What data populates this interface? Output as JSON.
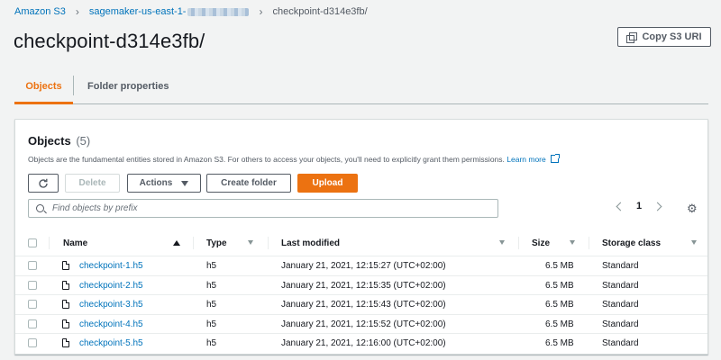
{
  "breadcrumb": {
    "root": "Amazon S3",
    "bucket": "sagemaker-us-east-1-",
    "current": "checkpoint-d314e3fb/"
  },
  "page_title": "checkpoint-d314e3fb/",
  "copy_button": "Copy S3 URI",
  "tabs": [
    {
      "label": "Objects",
      "active": true
    },
    {
      "label": "Folder properties",
      "active": false
    }
  ],
  "panel": {
    "title": "Objects",
    "count": "(5)",
    "description": "Objects are the fundamental entities stored in Amazon S3. For others to access your objects, you'll need to explicitly grant them permissions.",
    "learn_more": "Learn more"
  },
  "toolbar": {
    "delete": "Delete",
    "actions": "Actions",
    "create_folder": "Create folder",
    "upload": "Upload"
  },
  "search": {
    "placeholder": "Find objects by prefix"
  },
  "pagination": {
    "page": "1"
  },
  "columns": [
    "Name",
    "Type",
    "Last modified",
    "Size",
    "Storage class"
  ],
  "rows": [
    {
      "name": "checkpoint-1.h5",
      "type": "h5",
      "modified": "January 21, 2021, 12:15:27 (UTC+02:00)",
      "size": "6.5 MB",
      "storage": "Standard"
    },
    {
      "name": "checkpoint-2.h5",
      "type": "h5",
      "modified": "January 21, 2021, 12:15:35 (UTC+02:00)",
      "size": "6.5 MB",
      "storage": "Standard"
    },
    {
      "name": "checkpoint-3.h5",
      "type": "h5",
      "modified": "January 21, 2021, 12:15:43 (UTC+02:00)",
      "size": "6.5 MB",
      "storage": "Standard"
    },
    {
      "name": "checkpoint-4.h5",
      "type": "h5",
      "modified": "January 21, 2021, 12:15:52 (UTC+02:00)",
      "size": "6.5 MB",
      "storage": "Standard"
    },
    {
      "name": "checkpoint-5.h5",
      "type": "h5",
      "modified": "January 21, 2021, 12:16:00 (UTC+02:00)",
      "size": "6.5 MB",
      "storage": "Standard"
    }
  ],
  "colors": {
    "accent": "#ec7211",
    "link": "#0073bb",
    "background": "#f2f3f3"
  }
}
